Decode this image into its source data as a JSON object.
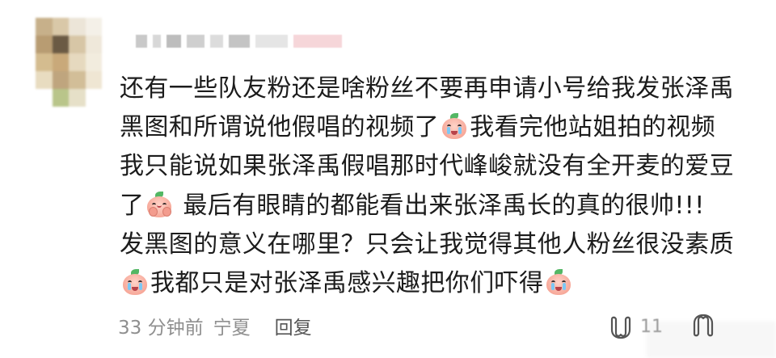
{
  "colors": {
    "text": "#1c1c1c",
    "meta": "#8f8f8f",
    "reply": "#555555"
  },
  "comment": {
    "lines": [
      {
        "before": "还有一些队友粉还是啥粉丝不要再申请小号给我发张泽禹",
        "emoji": "",
        "after": ""
      },
      {
        "before": "黑图和所谓说他假唱的视频了",
        "emoji": "crying-emoji",
        "after": "我看完他站姐拍的视频"
      },
      {
        "before": "我只能说如果张泽禹假唱那时代峰峻就没有全开麦的爱豆",
        "emoji": "",
        "after": ""
      },
      {
        "before": "了",
        "emoji": "pleading-emoji",
        "after": " 最后有眼睛的都能看出来张泽禹长的真的很帅!!!"
      },
      {
        "before": "发黑图的意义在哪里？只会让我觉得其他人粉丝很没素质",
        "emoji": "",
        "after": ""
      },
      {
        "before": "",
        "emoji": "crying-emoji",
        "after": "我都只是对张泽禹感兴趣把你们吓得"
      }
    ],
    "trailing_emoji": "crying-emoji"
  },
  "meta": {
    "time": "33 分钟前",
    "location": "宁夏",
    "reply_label": "回复"
  },
  "actions": {
    "like_icon": "like-icon",
    "like_count": "11",
    "dislike_icon": "dislike-icon"
  }
}
